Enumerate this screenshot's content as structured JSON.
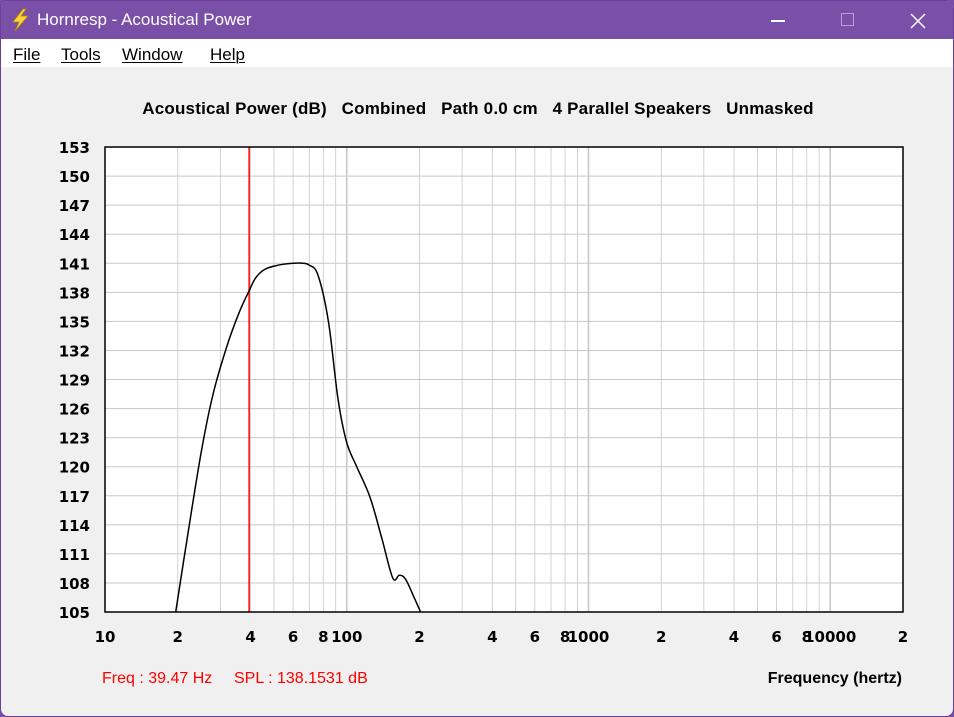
{
  "window": {
    "title": "Hornresp - Acoustical Power",
    "icon": "lightning-bolt-icon",
    "controls": [
      "minimize-icon",
      "maximize-icon",
      "close-icon"
    ]
  },
  "menu": {
    "file": "File",
    "tools": "Tools",
    "window": "Window",
    "help": "Help"
  },
  "chart_title": "Acoustical Power (dB)   Combined   Path 0.0 cm   4 Parallel Speakers   Unmasked",
  "readout": {
    "freq": "Freq : 39.47 Hz",
    "spl": "SPL : 138.1531 dB"
  },
  "colors": {
    "titlebar": "#7a4fa8",
    "marker": "#ff0000",
    "curve": "#000000",
    "grid": "#c8c8c8",
    "plot_background": "#ffffff"
  },
  "chart_data": {
    "type": "line",
    "title": "Acoustical Power (dB)   Combined   Path 0.0 cm   4 Parallel Speakers   Unmasked",
    "xlabel": "Frequency (hertz)",
    "ylabel": "",
    "x_scale": "log",
    "xlim": [
      10,
      20000
    ],
    "ylim": [
      105,
      153
    ],
    "grid": true,
    "x_tick_labels": [
      {
        "value": 10,
        "label": "10"
      },
      {
        "value": 20,
        "label": "2"
      },
      {
        "value": 40,
        "label": "4"
      },
      {
        "value": 60,
        "label": "6"
      },
      {
        "value": 80,
        "label": "8"
      },
      {
        "value": 100,
        "label": "100"
      },
      {
        "value": 200,
        "label": "2"
      },
      {
        "value": 400,
        "label": "4"
      },
      {
        "value": 600,
        "label": "6"
      },
      {
        "value": 800,
        "label": "8"
      },
      {
        "value": 1000,
        "label": "1000"
      },
      {
        "value": 2000,
        "label": "2"
      },
      {
        "value": 4000,
        "label": "4"
      },
      {
        "value": 6000,
        "label": "6"
      },
      {
        "value": 8000,
        "label": "8"
      },
      {
        "value": 10000,
        "label": "10000"
      },
      {
        "value": 20000,
        "label": "2"
      }
    ],
    "y_ticks": [
      105,
      108,
      111,
      114,
      117,
      120,
      123,
      126,
      129,
      132,
      135,
      138,
      141,
      144,
      147,
      150,
      153
    ],
    "series": [
      {
        "x": [
          19.6,
          22,
          25,
          28,
          32,
          36,
          39.47,
          42,
          46,
          52,
          60,
          66,
          70,
          76,
          84,
          92,
          100,
          110,
          125,
          140,
          155,
          165,
          175,
          190,
          202
        ],
        "y": [
          105,
          113,
          121.5,
          127.5,
          132.5,
          136,
          138.15,
          139.5,
          140.4,
          140.8,
          141,
          141,
          140.8,
          139.8,
          135,
          127,
          122.5,
          120,
          116.8,
          112.5,
          108.5,
          108.8,
          108.4,
          106.5,
          105
        ]
      }
    ],
    "marker": {
      "x": 39.47,
      "color": "#ff0000"
    }
  }
}
